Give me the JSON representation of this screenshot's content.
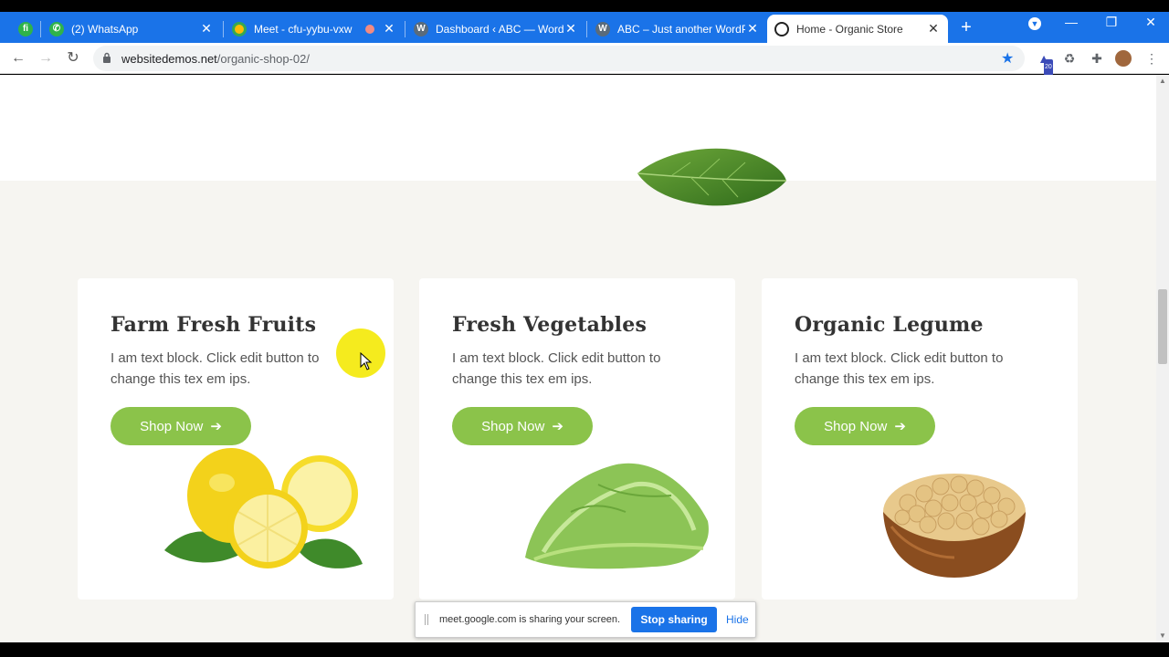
{
  "tabs": [
    {
      "title": "",
      "favicon": "fi"
    },
    {
      "title": "(2) WhatsApp",
      "favicon": "whatsapp-icon"
    },
    {
      "title": "Meet - cfu-yybu-vxw",
      "favicon": "meet-icon"
    },
    {
      "title": "Dashboard ‹ ABC — WordPress",
      "favicon": "wordpress-icon"
    },
    {
      "title": "ABC – Just another WordPress",
      "favicon": "wordpress-icon"
    },
    {
      "title": "Home - Organic Store",
      "favicon": "organic-icon"
    }
  ],
  "fi_label": "fi",
  "address_bar": {
    "domain": "websitedemos.net",
    "path": "/organic-shop-02/"
  },
  "extension_badge": "20",
  "cards": [
    {
      "title": "Farm Fresh Fruits",
      "text": "I am text block. Click edit button to change this tex em ips.",
      "button": "Shop Now"
    },
    {
      "title": "Fresh Vegetables",
      "text": "I am text block. Click edit button to change this tex em ips.",
      "button": "Shop Now"
    },
    {
      "title": "Organic Legume",
      "text": "I am text block. Click edit button to change this tex em ips.",
      "button": "Shop Now"
    }
  ],
  "sharebar": {
    "message": "meet.google.com is sharing your screen.",
    "stop_label": "Stop sharing",
    "hide_label": "Hide"
  },
  "colors": {
    "accent": "#1a73e8",
    "button_green": "#8bc34a"
  }
}
